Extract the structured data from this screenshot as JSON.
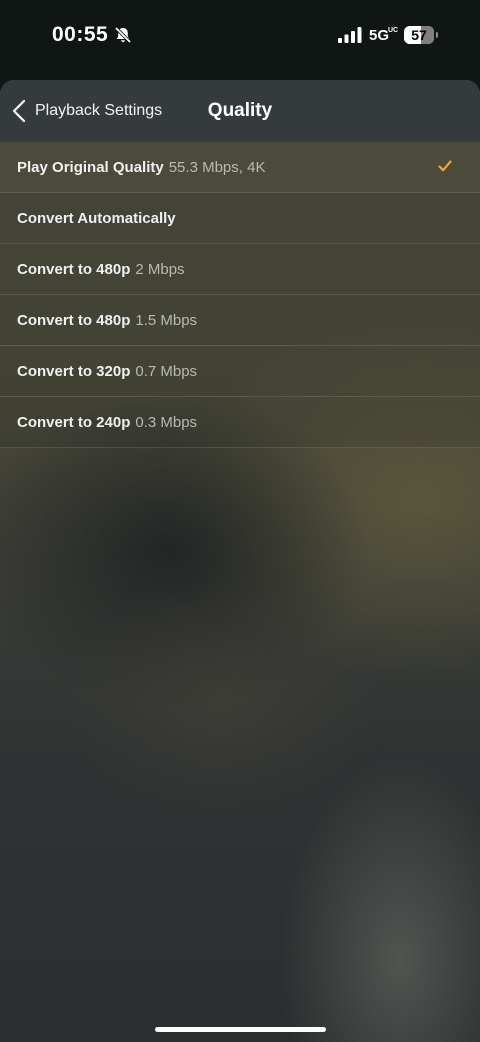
{
  "status_bar": {
    "time": "00:55",
    "network": "5G",
    "network_sub": "UC",
    "battery_percent": "57",
    "battery_level": 0.57,
    "icons": [
      "bell-slash-icon",
      "signal-icon"
    ]
  },
  "nav": {
    "back_label": "Playback Settings",
    "title": "Quality"
  },
  "options": [
    {
      "label": "Play Original Quality",
      "detail": "55.3 Mbps, 4K",
      "selected": true
    },
    {
      "label": "Convert Automatically",
      "detail": "",
      "selected": false
    },
    {
      "label": "Convert to 480p",
      "detail": "2 Mbps",
      "selected": false
    },
    {
      "label": "Convert to 480p",
      "detail": "1.5 Mbps",
      "selected": false
    },
    {
      "label": "Convert to 320p",
      "detail": "0.7 Mbps",
      "selected": false
    },
    {
      "label": "Convert to 240p",
      "detail": "0.3 Mbps",
      "selected": false
    }
  ],
  "colors": {
    "accent": "#f0a72a",
    "nav_background": "#353a3d"
  }
}
